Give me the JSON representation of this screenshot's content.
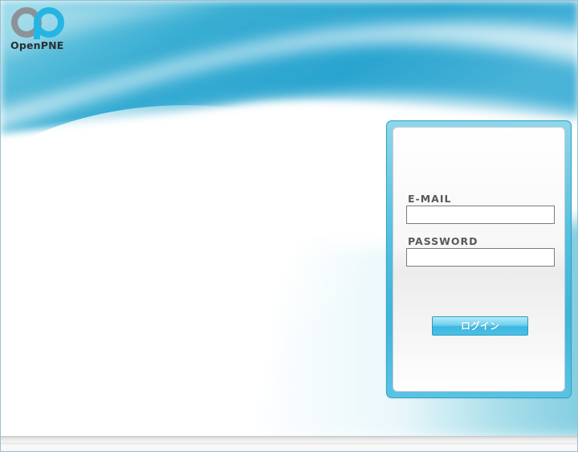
{
  "brand": {
    "name": "OpenPNE",
    "logo_icon": "openpne-logo-icon",
    "colors": {
      "logo_gray": "#8d9296",
      "logo_cyan": "#25b5e3",
      "accent": "#3fb4da"
    }
  },
  "login": {
    "email_label": "E-MAIL",
    "email_value": "",
    "password_label": "PASSWORD",
    "password_value": "",
    "submit_label": "ログイン"
  }
}
